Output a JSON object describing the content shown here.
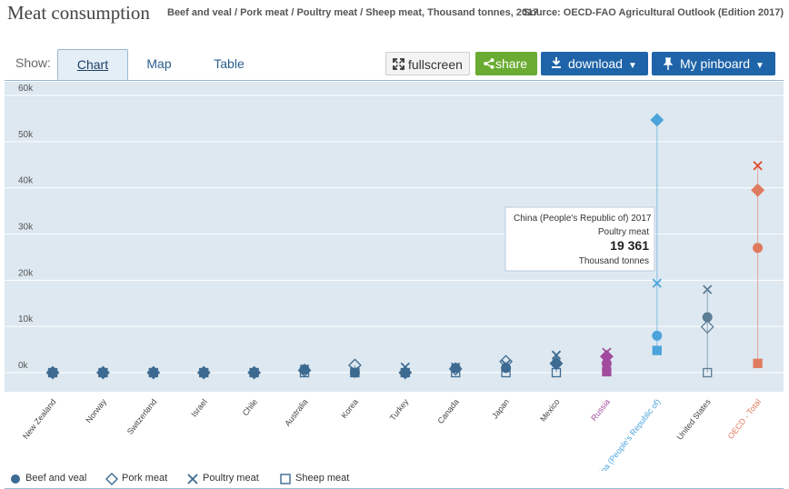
{
  "header": {
    "title": "Meat consumption",
    "subtitle": "Beef and veal / Pork meat / Poultry meat / Sheep meat, Thousand tonnes, 2017",
    "source": "Source: OECD-FAO Agricultural Outlook (Edition 2017)"
  },
  "toolbar": {
    "show_label": "Show:",
    "tabs": [
      "Chart",
      "Map",
      "Table"
    ],
    "fullscreen_label": "fullscreen",
    "share_label": "share",
    "download_label": "download",
    "pinboard_label": "My pinboard"
  },
  "colors": {
    "plot_bg": "#dde8f0",
    "default": "#3d6a91",
    "china": "#4ba3db",
    "russia": "#a24b9e",
    "oecd": "#e07a5f",
    "oecd_x": "#e0482d",
    "us": "#5c7d96"
  },
  "tooltip": {
    "header": "China (People's Republic of) 2017",
    "series": "Poultry meat",
    "value": "19 361",
    "unit": "Thousand tonnes"
  },
  "chart_data": {
    "type": "scatter",
    "categories": [
      "New Zealand",
      "Norway",
      "Switzerland",
      "Israel",
      "Chile",
      "Australia",
      "Korea",
      "Turkey",
      "Canada",
      "Japan",
      "Mexico",
      "Russia",
      "China (People's Republic of)",
      "United States",
      "OECD - Total"
    ],
    "series": [
      {
        "name": "Beef and veal",
        "values": [
          0,
          0,
          0,
          0,
          0,
          700,
          0,
          0,
          1000,
          1000,
          2000,
          2000,
          8000,
          12000,
          27000
        ]
      },
      {
        "name": "Pork meat",
        "values": [
          0,
          0,
          0,
          0,
          0,
          500,
          1600,
          0,
          800,
          2400,
          2000,
          3500,
          54700,
          9900,
          39500
        ]
      },
      {
        "name": "Poultry meat",
        "values": [
          0,
          0,
          0,
          0,
          0,
          800,
          400,
          1200,
          1200,
          1800,
          3800,
          4400,
          19361,
          18000,
          44800
        ]
      },
      {
        "name": "Sheep meat",
        "values": [
          0,
          0,
          0,
          0,
          0,
          0,
          0,
          0,
          0,
          0,
          0,
          200,
          4800,
          0,
          2000
        ]
      }
    ],
    "yticks": [
      "0k",
      "10k",
      "20k",
      "30k",
      "40k",
      "50k",
      "60k"
    ],
    "ylim": [
      -4000,
      62000
    ],
    "legend_position": "bottom-left"
  }
}
